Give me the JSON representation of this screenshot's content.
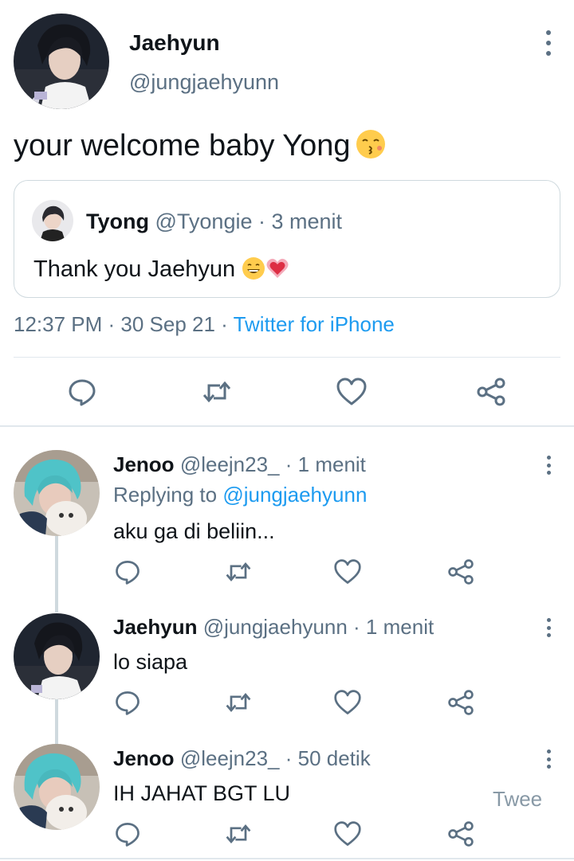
{
  "main_tweet": {
    "name": "Jaehyun",
    "handle": "@jungjaehyunn",
    "text": "your welcome baby Yong",
    "text_emoji": "kissing-face-emoji",
    "quote": {
      "name": "Tyong",
      "handle": "@Tyongie",
      "separator": "·",
      "time": "3 menit",
      "text": "Thank you Jaehyun",
      "emojis": [
        "grinning-face-emoji",
        "sparkling-heart-emoji"
      ]
    },
    "timestamp": "12:37 PM · 30 Sep 21 · ",
    "source": "Twitter for iPhone",
    "actions": [
      "reply-icon",
      "retweet-icon",
      "like-icon",
      "share-icon"
    ]
  },
  "replies": [
    {
      "name": "Jenoo",
      "handle": "@leejn23_",
      "meta": " · 1 menit",
      "replying_prefix": "Replying to ",
      "replying_to": "@jungjaehyunn",
      "text": "aku ga di beliin..."
    },
    {
      "name": "Jaehyun",
      "handle": "@jungjaehyunn",
      "meta": " · 1 menit",
      "text": "lo siapa"
    },
    {
      "name": "Jenoo",
      "handle": "@leejn23_",
      "meta": " · 50 detik",
      "text": "IH JAHAT BGT LU"
    }
  ],
  "floating_label": "Twee",
  "colors": {
    "text": "#0f1419",
    "muted": "#5b7083",
    "link": "#1d9bf0",
    "border": "#cfd9de"
  }
}
